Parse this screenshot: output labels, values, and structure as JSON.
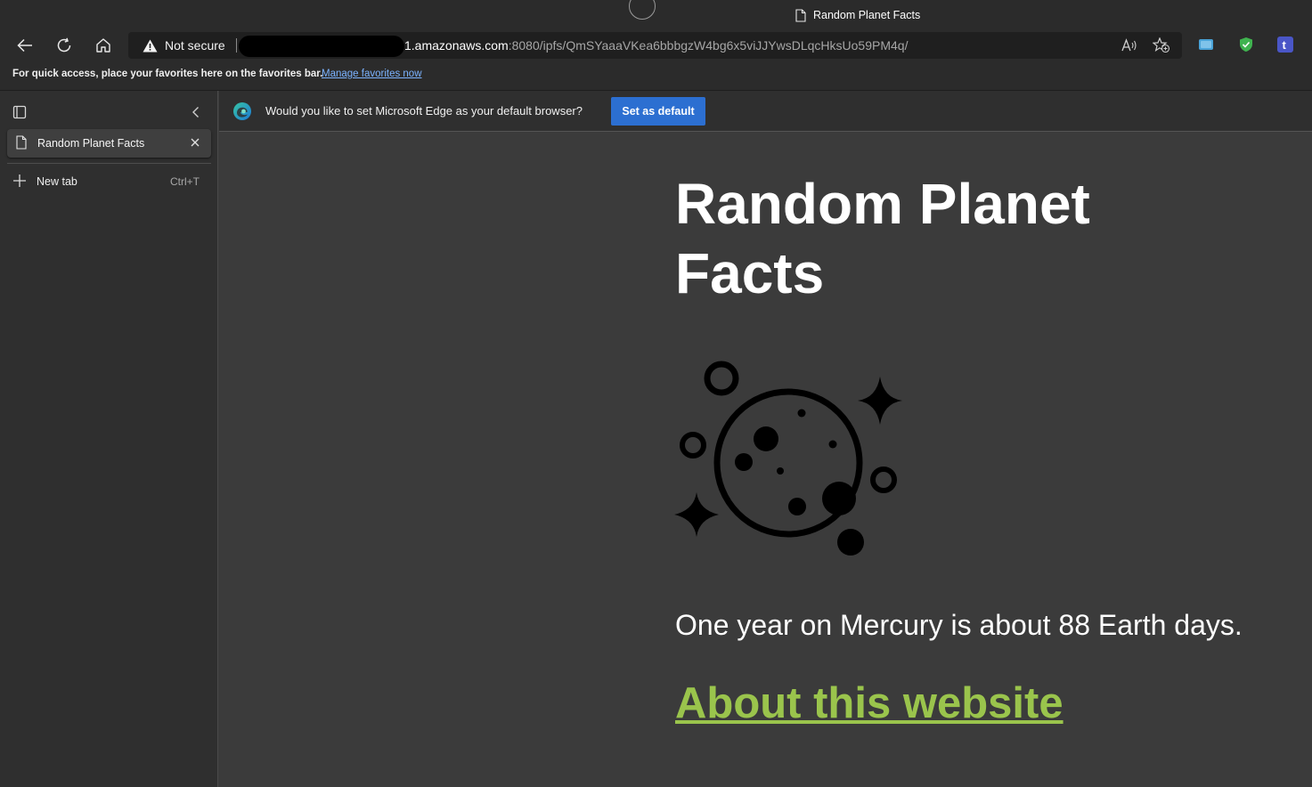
{
  "window": {
    "title": "Random Planet Facts"
  },
  "address_bar": {
    "security_label": "Not secure",
    "url_host": "1.amazonaws.com",
    "url_rest": ":8080/ipfs/QmSYaaaVKea6bbbgzW4bg6x5viJJYwsDLqcHksUo59PM4q/"
  },
  "favorites_bar": {
    "text": "For quick access, place your favorites here on the favorites bar.",
    "link": "Manage favorites now"
  },
  "sidebar": {
    "tabs": [
      {
        "label": "Random Planet Facts"
      }
    ],
    "new_tab": {
      "label": "New tab",
      "shortcut": "Ctrl+T"
    }
  },
  "infobar": {
    "message": "Would you like to set Microsoft Edge as your default browser?",
    "button": "Set as default"
  },
  "page": {
    "heading": "Random Planet Facts",
    "fact": "One year on Mercury is about 88 Earth days.",
    "about_link": "About this website",
    "link_color": "#9ac44c"
  },
  "icons": [
    "back-icon",
    "refresh-icon",
    "home-icon",
    "warning-icon",
    "read-aloud-icon",
    "add-favorite-icon",
    "collections-icon",
    "shield-extension-icon",
    "tumblr-extension-icon",
    "tab-actions-icon",
    "collapse-icon",
    "page-icon",
    "close-icon",
    "plus-icon",
    "edge-logo-icon",
    "planet-illustration"
  ]
}
